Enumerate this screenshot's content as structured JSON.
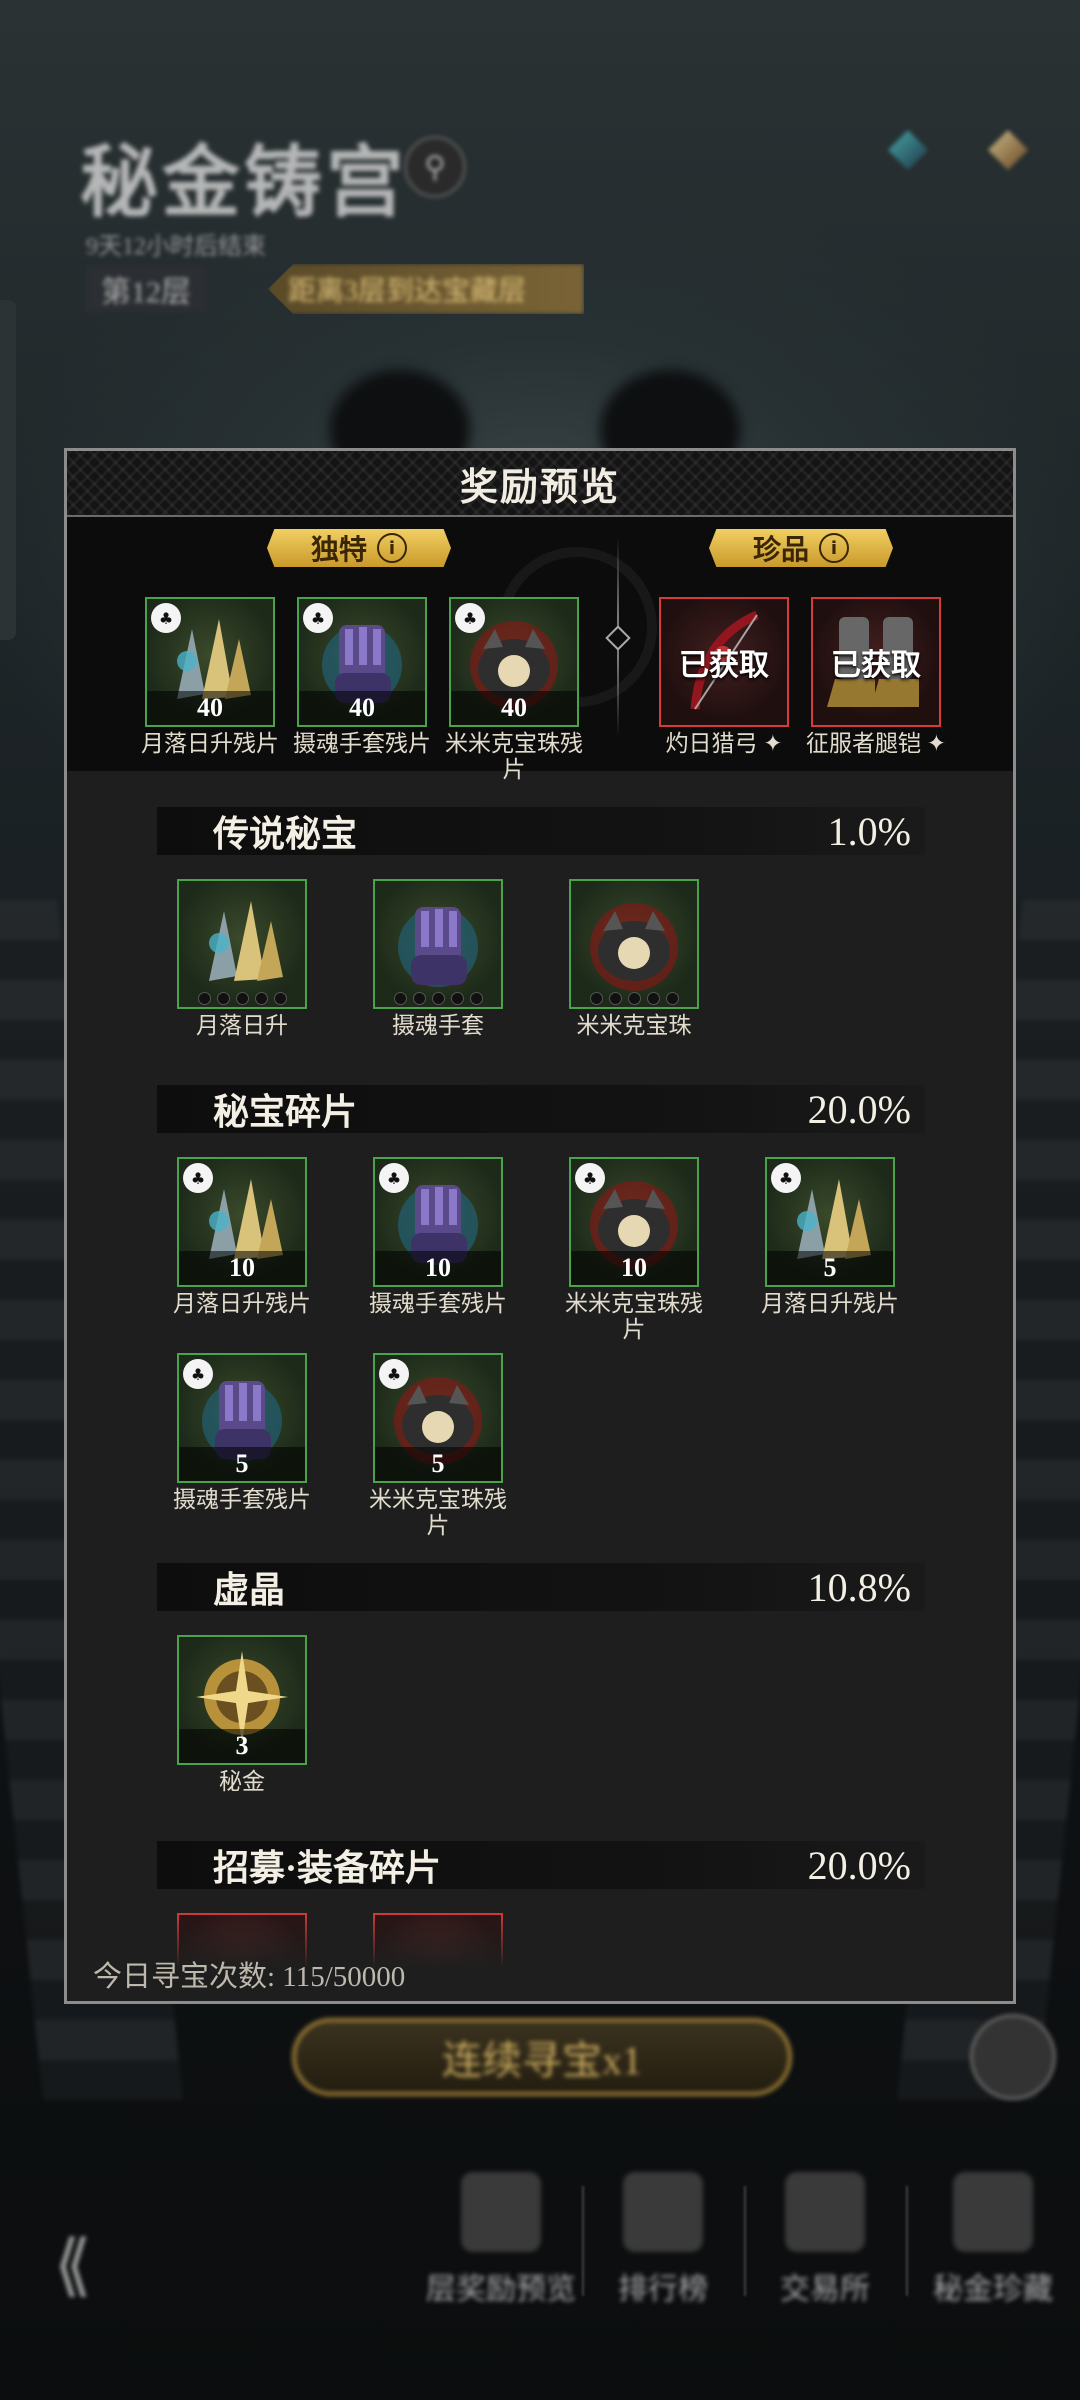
{
  "page": {
    "title": "秘金铸宫",
    "subtitle": "9天12小时后结束",
    "floor": "第12层",
    "floor_tip": "距离3层到达宝藏层"
  },
  "dialog": {
    "title": "奖励预览",
    "featured": {
      "unique_label": "独特",
      "rare_label": "珍品",
      "unique_items": [
        {
          "name": "月落日升残片",
          "qty": "40",
          "icon": "sunset-shards-icon"
        },
        {
          "name": "摄魂手套残片",
          "qty": "40",
          "icon": "soul-gauntlet-icon"
        },
        {
          "name": "米米克宝珠残片",
          "qty": "40",
          "icon": "mimic-orb-icon"
        }
      ],
      "rare_items": [
        {
          "name": "灼日猎弓",
          "status": "已获取",
          "icon": "scorching-bow-icon"
        },
        {
          "name": "征服者腿铠",
          "status": "已获取",
          "icon": "conqueror-greaves-icon"
        }
      ]
    },
    "sections": [
      {
        "name": "传说秘宝",
        "percent": "1.0%",
        "items": [
          {
            "name": "月落日升",
            "icon": "sunset-shards-icon"
          },
          {
            "name": "摄魂手套",
            "icon": "soul-gauntlet-icon"
          },
          {
            "name": "米米克宝珠",
            "icon": "mimic-orb-icon"
          }
        ]
      },
      {
        "name": "秘宝碎片",
        "percent": "20.0%",
        "items": [
          {
            "name": "月落日升残片",
            "qty": "10",
            "icon": "sunset-shards-icon"
          },
          {
            "name": "摄魂手套残片",
            "qty": "10",
            "icon": "soul-gauntlet-icon"
          },
          {
            "name": "米米克宝珠残片",
            "qty": "10",
            "icon": "mimic-orb-icon"
          },
          {
            "name": "月落日升残片",
            "qty": "5",
            "icon": "sunset-shards-icon"
          },
          {
            "name": "摄魂手套残片",
            "qty": "5",
            "icon": "soul-gauntlet-icon"
          },
          {
            "name": "米米克宝珠残片",
            "qty": "5",
            "icon": "mimic-orb-icon"
          }
        ]
      },
      {
        "name": "虚晶",
        "percent": "10.8%",
        "items": [
          {
            "name": "秘金",
            "qty": "3",
            "icon": "compass-medal-icon"
          }
        ]
      },
      {
        "name": "招募·装备碎片",
        "percent": "20.0%",
        "items": []
      }
    ],
    "daily_label": "今日寻宝次数: 115/50000"
  },
  "bottom": {
    "continue_button": "连续寻宝x1",
    "nav": [
      {
        "label": "层奖励预览",
        "icon": "chest-icon"
      },
      {
        "label": "排行榜",
        "icon": "trophy-icon"
      },
      {
        "label": "交易所",
        "icon": "shop-icon"
      },
      {
        "label": "秘金珍藏",
        "icon": "gallery-icon"
      }
    ]
  }
}
